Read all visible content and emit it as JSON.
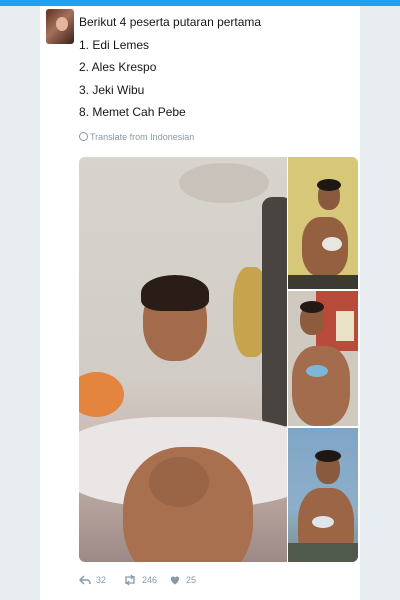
{
  "tweet": {
    "lines": [
      "Berikut 4 peserta putaran pertama",
      "1. Edi Lemes",
      "2. Ales Krespo",
      "3. Jeki Wibu",
      "8. Memet Cah Pebe"
    ],
    "translate_label": "Translate from Indonesian"
  },
  "actions": {
    "reply_count": "32",
    "retweet_count": "246",
    "like_count": "25"
  },
  "colors": {
    "accent": "#1da1f2",
    "muted": "#8899a6",
    "text": "#14171a"
  },
  "icons": [
    "reply-icon",
    "retweet-icon",
    "heart-icon",
    "globe-icon"
  ]
}
